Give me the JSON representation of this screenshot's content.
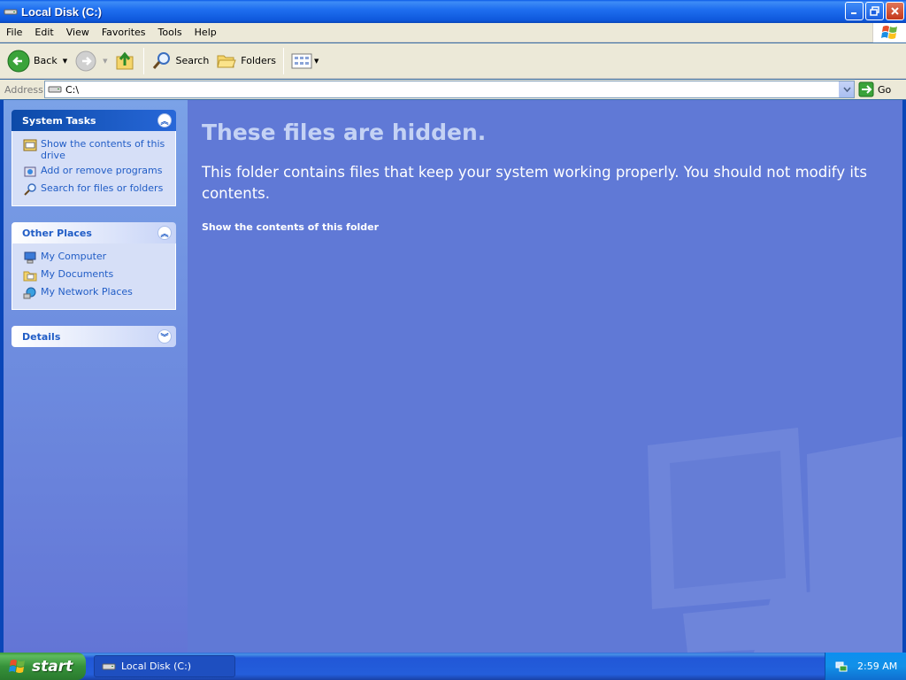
{
  "window": {
    "title": "Local Disk (C:)"
  },
  "menu": {
    "items": [
      "File",
      "Edit",
      "View",
      "Favorites",
      "Tools",
      "Help"
    ]
  },
  "toolbar": {
    "back_label": "Back",
    "search_label": "Search",
    "folders_label": "Folders"
  },
  "address": {
    "label": "Address",
    "value": "C:\\",
    "go_label": "Go"
  },
  "sidebar": {
    "system_tasks": {
      "title": "System Tasks",
      "items": [
        {
          "label": "Show the contents of this drive",
          "icon": "show-contents-icon"
        },
        {
          "label": "Add or remove programs",
          "icon": "add-remove-programs-icon"
        },
        {
          "label": "Search for files or folders",
          "icon": "search-icon"
        }
      ]
    },
    "other_places": {
      "title": "Other Places",
      "items": [
        {
          "label": "My Computer",
          "icon": "my-computer-icon"
        },
        {
          "label": "My Documents",
          "icon": "my-documents-icon"
        },
        {
          "label": "My Network Places",
          "icon": "network-places-icon"
        }
      ]
    },
    "details": {
      "title": "Details"
    }
  },
  "content": {
    "heading": "These files are hidden.",
    "message": "This folder contains files that keep your system working properly. You should not modify its contents.",
    "link": "Show the contents of this folder"
  },
  "taskbar": {
    "start_label": "start",
    "task_item": "Local Disk (C:)",
    "clock": "2:59 AM"
  },
  "colors": {
    "title_blue": "#0a5ae6",
    "pane_blue": "#6079d6",
    "link_blue": "#215dc6",
    "start_green": "#36923a"
  }
}
